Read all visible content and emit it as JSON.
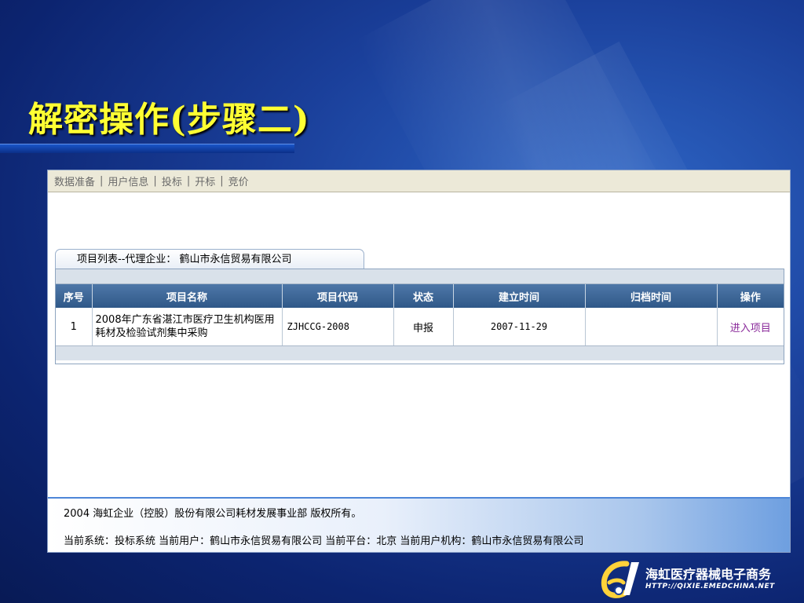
{
  "slide": {
    "title": "解密操作(步骤二)"
  },
  "menu": {
    "items": [
      "数据准备",
      "用户信息",
      "投标",
      "开标",
      "竞价"
    ],
    "separator": "|"
  },
  "project_list": {
    "tab_label": "项目列表--代理企业：  鹤山市永信贸易有限公司",
    "columns": [
      "序号",
      "项目名称",
      "项目代码",
      "状态",
      "建立时间",
      "归档时间",
      "操作"
    ],
    "rows": [
      {
        "index": "1",
        "name": "2008年广东省湛江市医疗卫生机构医用耗材及检验试剂集中采购",
        "code": "ZJHCCG-2008",
        "status": "申报",
        "created": "2007-11-29",
        "archived": "",
        "action": "进入项目"
      }
    ]
  },
  "footer": {
    "copyright": "2004 海虹企业（控股）股份有限公司耗材发展事业部 版权所有。",
    "status_line": "当前系统：投标系统  当前用户：鹤山市永信贸易有限公司  当前平台：北京  当前用户机构：鹤山市永信贸易有限公司"
  },
  "logo": {
    "name": "海虹医疗器械电子商务",
    "url": "HTTP://QIXIE.EMEDCHINA.NET"
  },
  "colors": {
    "title": "#ffff33",
    "table_header": "#3d6696",
    "action_link": "#8a2a9a"
  }
}
